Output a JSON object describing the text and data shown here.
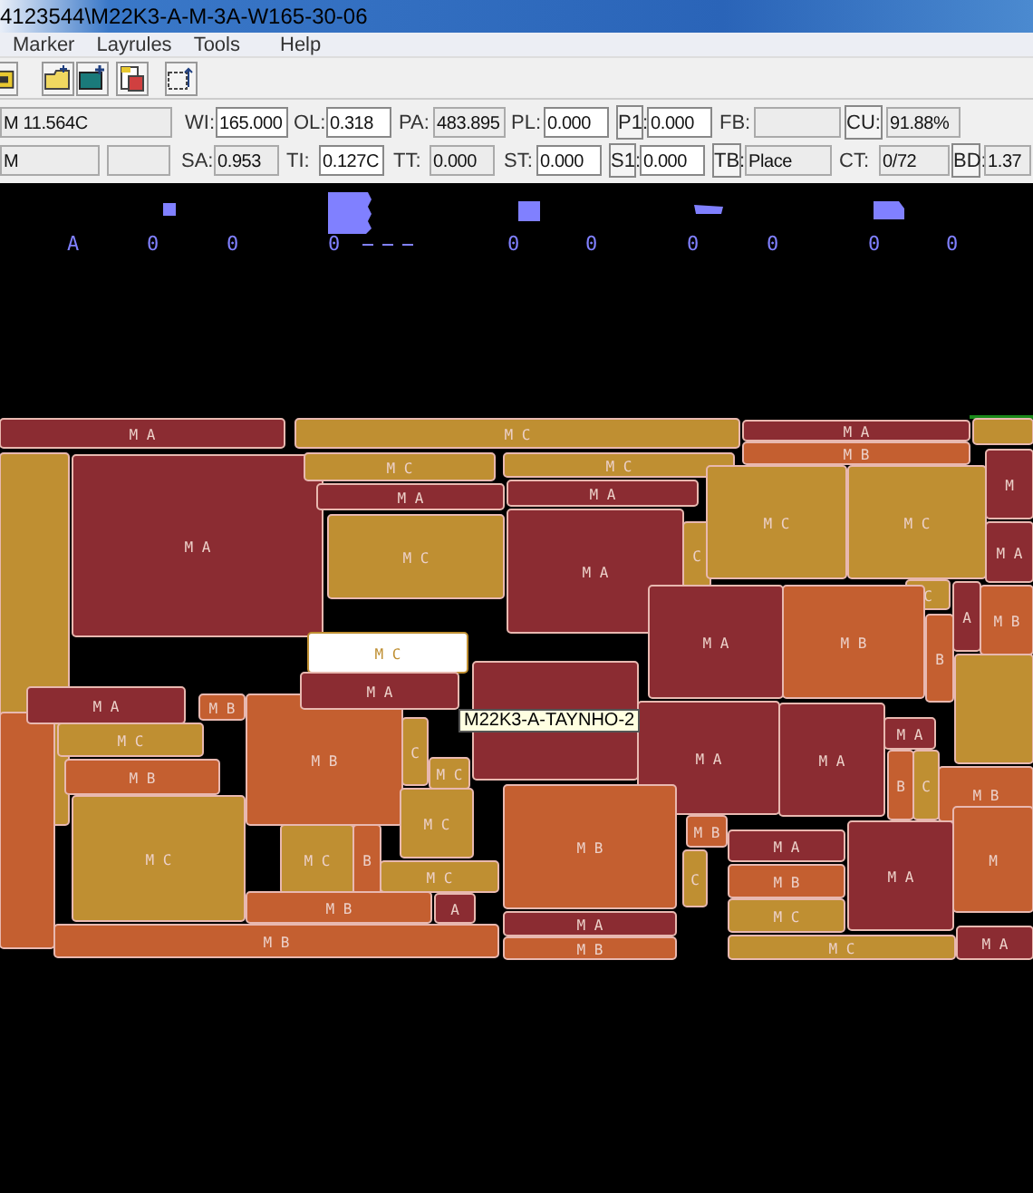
{
  "window": {
    "title": "4123544\\M22K3-A-M-3A-W165-30-06"
  },
  "menu": [
    "Marker",
    "Layrules",
    "Tools",
    "Help"
  ],
  "status_rows": [
    [
      {
        "value": "M 11.564C",
        "readonly": true
      },
      {
        "label": "WI:",
        "value": "165.000",
        "readonly": false
      },
      {
        "label": "OL:",
        "value": "0.318",
        "readonly": false
      },
      {
        "label": "PA:",
        "value": "483.895",
        "readonly": true
      },
      {
        "label": "PL:",
        "value": "0.000",
        "readonly": false
      },
      {
        "label": "P1:",
        "label_button": true,
        "value": "0.000",
        "readonly": false
      },
      {
        "label": "FB:",
        "readonly": true
      },
      {
        "label": "CU:",
        "label_button": true,
        "value": "91.88%",
        "readonly": true
      }
    ],
    [
      {
        "value": "M",
        "readonly": true
      },
      {
        "readonly": true
      },
      {
        "label": "SA:",
        "value": "0.953",
        "readonly": true
      },
      {
        "label": "TI:",
        "value": "0.127C",
        "readonly": false
      },
      {
        "label": "TT:",
        "value": "0.000",
        "readonly": true
      },
      {
        "label": "ST:",
        "value": "0.000",
        "readonly": false
      },
      {
        "label": "S1:",
        "label_button": true,
        "value": "0.000",
        "readonly": false
      },
      {
        "label": "TB:",
        "label_button": true,
        "value": "Place",
        "readonly": true
      },
      {
        "label": "CT:",
        "value": "0/72",
        "readonly": true
      },
      {
        "label": "BD:",
        "label_button": true,
        "value": "1.37",
        "readonly": true
      }
    ]
  ],
  "strip_labels": [
    "A",
    "0",
    "0",
    "0",
    "0",
    "0",
    "0",
    "0",
    "0",
    "0"
  ],
  "pieces": [
    {
      "label": "M A",
      "color": "#8b2c32",
      "selected": false
    },
    {
      "label": "M C",
      "color": "#bf8f32",
      "selected": false
    },
    {
      "label": "M A",
      "color": "#8b2c32",
      "selected": false
    },
    {
      "label": "M B",
      "color": "#c45f30",
      "selected": false
    },
    {
      "color": "#bf8f32",
      "selected": false
    },
    {
      "color": "#bf8f32",
      "selected": false
    },
    {
      "label": "M A",
      "color": "#8b2c32",
      "selected": false
    },
    {
      "label": "M C",
      "color": "#bf8f32",
      "selected": false
    },
    {
      "label": "M A",
      "color": "#8b2c32",
      "selected": false
    },
    {
      "label": "M C",
      "color": "#bf8f32",
      "selected": false
    },
    {
      "label": "M C",
      "color": "#bf8f32",
      "selected": true
    },
    {
      "label": "M C",
      "color": "#bf8f32",
      "selected": false
    },
    {
      "label": "M A",
      "color": "#8b2c32",
      "selected": false
    },
    {
      "label": "M A",
      "color": "#8b2c32",
      "selected": false
    },
    {
      "label": "C",
      "color": "#bf8f32",
      "selected": false
    },
    {
      "label": "M C",
      "color": "#bf8f32",
      "selected": false
    },
    {
      "label": "M C",
      "color": "#bf8f32",
      "selected": false
    },
    {
      "label": "M",
      "color": "#8b2c32",
      "selected": false
    },
    {
      "label": "M A",
      "color": "#8b2c32",
      "selected": false
    },
    {
      "label": "C",
      "color": "#bf8f32",
      "selected": false
    },
    {
      "label": "M A",
      "color": "#8b2c32",
      "selected": false
    },
    {
      "label": "M B",
      "color": "#c45f30",
      "selected": false
    },
    {
      "label": "A",
      "color": "#8b2c32",
      "selected": false
    },
    {
      "label": "B",
      "color": "#c45f30",
      "selected": false
    },
    {
      "label": "M B",
      "color": "#c45f30",
      "selected": false
    },
    {
      "color": "#bf8f32",
      "selected": false
    },
    {
      "color": "#c45f30",
      "selected": false
    },
    {
      "label": "M A",
      "color": "#8b2c32",
      "selected": false
    },
    {
      "label": "M B",
      "color": "#c45f30",
      "selected": false
    },
    {
      "label": "M C",
      "color": "#bf8f32",
      "selected": false
    },
    {
      "label": "M B",
      "color": "#c45f30",
      "selected": false
    },
    {
      "label": "M C",
      "color": "#bf8f32",
      "selected": false
    },
    {
      "label": "M B",
      "color": "#c45f30",
      "selected": false
    },
    {
      "label": "M A",
      "color": "#8b2c32",
      "selected": false
    },
    {
      "label": "C",
      "color": "#bf8f32",
      "selected": false
    },
    {
      "label": "M C",
      "color": "#bf8f32",
      "selected": false
    },
    {
      "label": "M C",
      "color": "#bf8f32",
      "selected": false
    },
    {
      "label": "M C",
      "color": "#bf8f32",
      "selected": false
    },
    {
      "label": "B",
      "color": "#c45f30",
      "selected": false
    },
    {
      "label": "M C",
      "color": "#bf8f32",
      "selected": false
    },
    {
      "label": "A",
      "color": "#8b2c32",
      "selected": false
    },
    {
      "label": "M B",
      "color": "#c45f30",
      "selected": false
    },
    {
      "label": "M B",
      "color": "#c45f30",
      "selected": false
    },
    {
      "color": "#8b2c32",
      "selected": false
    },
    {
      "label": "M A",
      "color": "#8b2c32",
      "selected": false
    },
    {
      "label": "M A",
      "color": "#8b2c32",
      "selected": false
    },
    {
      "label": "M A",
      "color": "#8b2c32",
      "selected": false
    },
    {
      "label": "B",
      "color": "#c45f30",
      "selected": false
    },
    {
      "label": "C",
      "color": "#bf8f32",
      "selected": false
    },
    {
      "label": "M B",
      "color": "#c45f30",
      "selected": false
    },
    {
      "label": "M B",
      "color": "#c45f30",
      "selected": false
    },
    {
      "label": "M B",
      "color": "#c45f30",
      "selected": false
    },
    {
      "label": "C",
      "color": "#bf8f32",
      "selected": false
    },
    {
      "label": "M A",
      "color": "#8b2c32",
      "selected": false
    },
    {
      "label": "M B",
      "color": "#c45f30",
      "selected": false
    },
    {
      "label": "M C",
      "color": "#bf8f32",
      "selected": false
    },
    {
      "label": "M A",
      "color": "#8b2c32",
      "selected": false
    },
    {
      "label": "M",
      "color": "#c45f30",
      "selected": false
    },
    {
      "label": "M A",
      "color": "#8b2c32",
      "selected": false
    },
    {
      "label": "M B",
      "color": "#c45f30",
      "selected": false
    },
    {
      "label": "M C",
      "color": "#bf8f32",
      "selected": false
    },
    {
      "label": "M A",
      "color": "#8b2c32",
      "selected": false
    }
  ],
  "tooltip": "M22K3-A-TAYNHO-2"
}
